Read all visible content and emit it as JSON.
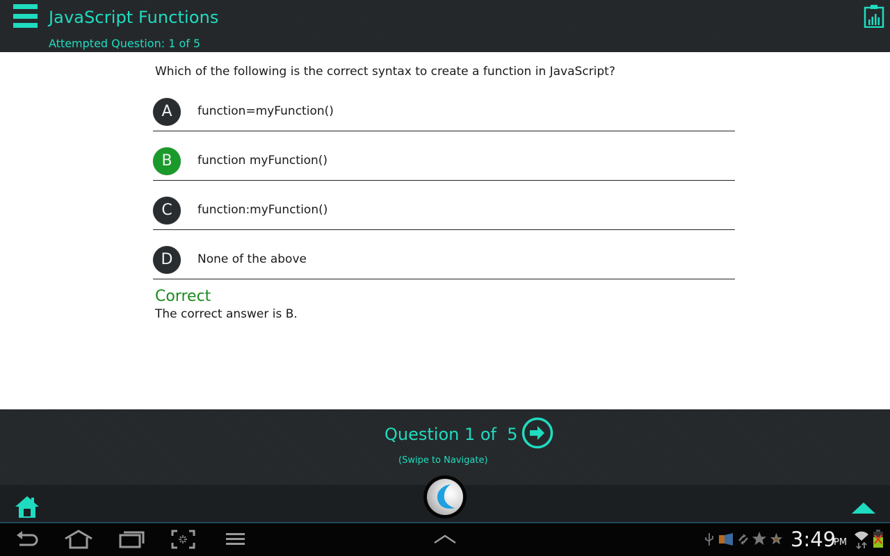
{
  "header": {
    "title": "JavaScript Functions",
    "attempted": "Attempted Question: 1 of 5",
    "menu_icon": "hamburger-menu-icon",
    "report_icon": "clipboard-chart-icon",
    "accent_color": "#1fdcc0"
  },
  "quiz": {
    "question": "Which of the following is the correct syntax to create a function in JavaScript?",
    "options": [
      {
        "letter": "A",
        "text": "function=myFunction()",
        "selected": false
      },
      {
        "letter": "B",
        "text": "function myFunction()",
        "selected": true
      },
      {
        "letter": "C",
        "text": "function:myFunction()",
        "selected": false
      },
      {
        "letter": "D",
        "text": "None of the above",
        "selected": false
      }
    ],
    "result_title": "Correct",
    "result_text": "The correct answer is B.",
    "correct_color": "#1a9a2a"
  },
  "navigation": {
    "question_counter": "Question 1 of  5",
    "swipe_hint": "(Swipe to Navigate)",
    "next_icon": "arrow-right-circle-icon",
    "home_icon": "home-icon",
    "up_icon": "triangle-up-icon",
    "logo_icon": "app-logo-icon"
  },
  "system_bar": {
    "buttons": [
      "back",
      "home",
      "recent-apps",
      "screenshot",
      "menu"
    ],
    "center_icon": "chevron-up-icon",
    "time": "3:49",
    "ampm": "PM",
    "status_icons": [
      "usb-icon",
      "media-icon",
      "sync-icon",
      "star-icon",
      "star-small-icon",
      "wifi-icon",
      "battery-icon"
    ]
  }
}
